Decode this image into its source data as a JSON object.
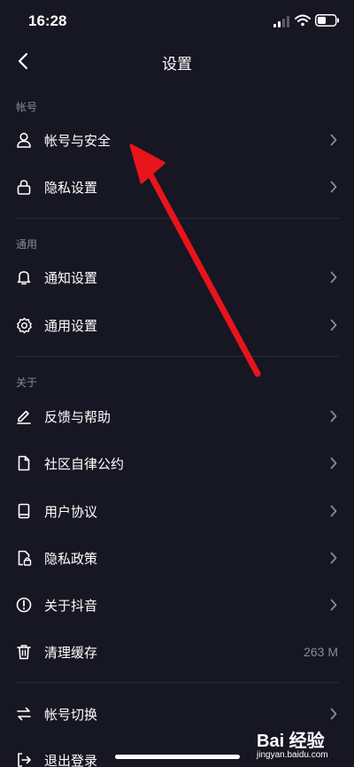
{
  "status_bar": {
    "time": "16:28"
  },
  "nav": {
    "title": "设置"
  },
  "sections": {
    "account": {
      "header": "帐号",
      "items": [
        {
          "label": "帐号与安全",
          "icon": "user-icon"
        },
        {
          "label": "隐私设置",
          "icon": "lock-icon"
        }
      ]
    },
    "general": {
      "header": "通用",
      "items": [
        {
          "label": "通知设置",
          "icon": "bell-icon"
        },
        {
          "label": "通用设置",
          "icon": "gear-icon"
        }
      ]
    },
    "about": {
      "header": "关于",
      "items": [
        {
          "label": "反馈与帮助",
          "icon": "pencil-icon"
        },
        {
          "label": "社区自律公约",
          "icon": "document-icon"
        },
        {
          "label": "用户协议",
          "icon": "book-icon"
        },
        {
          "label": "隐私政策",
          "icon": "document-lock-icon"
        },
        {
          "label": "关于抖音",
          "icon": "info-icon"
        },
        {
          "label": "清理缓存",
          "icon": "trash-icon",
          "value": "263 M"
        }
      ]
    },
    "session": {
      "items": [
        {
          "label": "帐号切换",
          "icon": "switch-icon"
        },
        {
          "label": "退出登录",
          "icon": "logout-icon"
        }
      ]
    }
  },
  "watermark": {
    "brand": "Bai 经验",
    "url": "jingyan.baidu.com"
  },
  "colors": {
    "background": "#161722",
    "text": "#ffffff",
    "secondary_text": "#8a8b94",
    "divider": "#2a2b36",
    "annotation_arrow": "#e8141c"
  }
}
